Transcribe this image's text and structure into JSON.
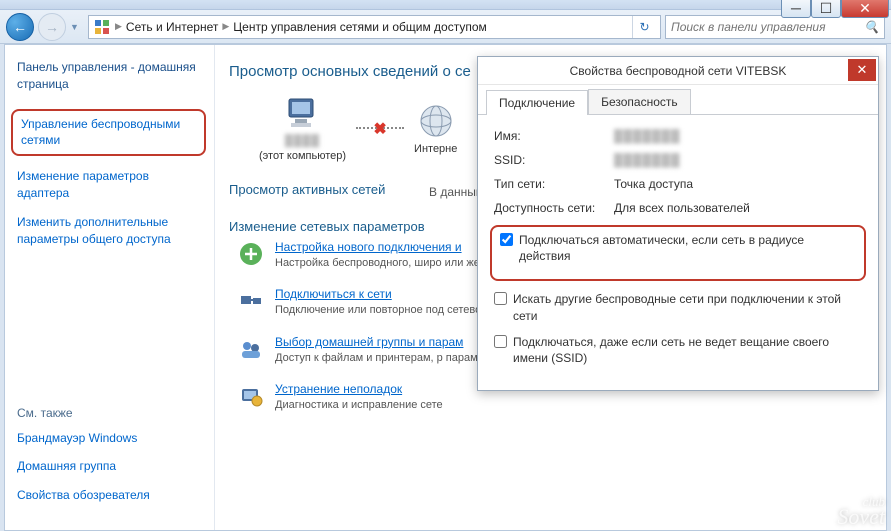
{
  "window": {
    "min_tooltip": "Свернуть",
    "max_tooltip": "Развернуть",
    "close_tooltip": "Закрыть"
  },
  "breadcrumb": {
    "part1": "Сеть и Интернет",
    "part2": "Центр управления сетями и общим доступом"
  },
  "search": {
    "placeholder": "Поиск в панели управления"
  },
  "sidebar": {
    "home": "Панель управления - домашняя страница",
    "links": [
      "Управление беспроводными сетями",
      "Изменение параметров адаптера",
      "Изменить дополнительные параметры общего доступа"
    ],
    "seealso_title": "См. также",
    "seealso": [
      "Брандмауэр Windows",
      "Домашняя группа",
      "Свойства обозревателя"
    ]
  },
  "content": {
    "heading": "Просмотр основных сведений о се",
    "node_this": "(этот компьютер)",
    "node_internet": "Интерне",
    "active_title": "Просмотр активных сетей",
    "active_sub": "В данный момент",
    "change_title": "Изменение сетевых параметров",
    "tasks": [
      {
        "title": "Настройка нового подключения и",
        "desc": "Настройка беспроводного, широ\nили же настройка маршрутизато"
      },
      {
        "title": "Подключиться к сети",
        "desc": "Подключение или повторное под\nсетевому соединению или подкл"
      },
      {
        "title": "Выбор домашней группы и парам",
        "desc": "Доступ к файлам и принтерам, р\nпараметров общего доступа."
      },
      {
        "title": "Устранение неполадок",
        "desc": "Диагностика и исправление сете"
      }
    ]
  },
  "dialog": {
    "title": "Свойства беспроводной сети VITEBSK",
    "tabs": [
      "Подключение",
      "Безопасность"
    ],
    "props": {
      "name_label": "Имя:",
      "ssid_label": "SSID:",
      "type_label": "Тип сети:",
      "type_value": "Точка доступа",
      "avail_label": "Доступность сети:",
      "avail_value": "Для всех пользователей"
    },
    "checks": {
      "auto": "Подключаться автоматически, если сеть в радиусе действия",
      "other": "Искать другие беспроводные сети при подключении к этой сети",
      "hidden": "Подключаться, даже если сеть не ведет вещание своего имени (SSID)"
    }
  },
  "watermark": {
    "small": "club",
    "big": "Sovet"
  }
}
